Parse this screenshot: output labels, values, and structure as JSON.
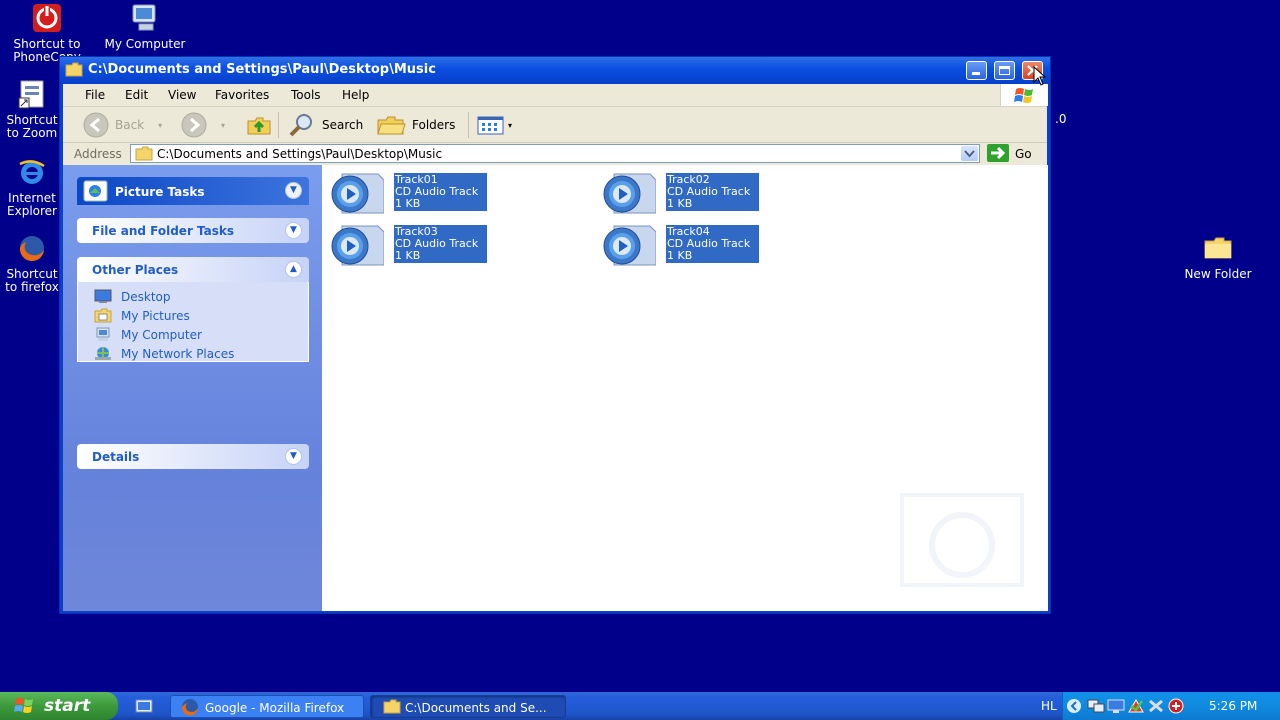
{
  "desktop": {
    "icons": [
      {
        "label": "Shortcut to PhoneCopy",
        "icon": "phonecopy-icon"
      },
      {
        "label": "My Computer",
        "icon": "my-computer-icon"
      },
      {
        "label": "Shortcut to Zoom",
        "icon": "zoom-shortcut-icon"
      },
      {
        "label": "Internet Explorer",
        "icon": "internet-explorer-icon"
      },
      {
        "label": "Shortcut to firefox",
        "icon": "firefox-icon"
      },
      {
        "label": "New Folder",
        "icon": "folder-icon"
      }
    ],
    "partial_text": ".0"
  },
  "window": {
    "title": "C:\\Documents and Settings\\Paul\\Desktop\\Music",
    "menu": [
      "File",
      "Edit",
      "View",
      "Favorites",
      "Tools",
      "Help"
    ],
    "toolbar": {
      "back_label": "Back",
      "search_label": "Search",
      "folders_label": "Folders"
    },
    "address": {
      "label": "Address",
      "value": "C:\\Documents and Settings\\Paul\\Desktop\\Music",
      "go_label": "Go"
    },
    "tasks": {
      "picture_tasks": "Picture Tasks",
      "file_folder_tasks": "File and Folder Tasks",
      "other_places": "Other Places",
      "places": [
        "Desktop",
        "My Pictures",
        "My Computer",
        "My Network Places"
      ],
      "details": "Details"
    },
    "files": [
      {
        "name": "Track01",
        "type": "CD Audio Track",
        "size": "1 KB"
      },
      {
        "name": "Track02",
        "type": "CD Audio Track",
        "size": "1 KB"
      },
      {
        "name": "Track03",
        "type": "CD Audio Track",
        "size": "1 KB"
      },
      {
        "name": "Track04",
        "type": "CD Audio Track",
        "size": "1 KB"
      }
    ]
  },
  "taskbar": {
    "start_label": "start",
    "buttons": [
      {
        "label": "Google - Mozilla Firefox",
        "active": false
      },
      {
        "label": "C:\\Documents and Se...",
        "active": true
      }
    ],
    "language": "HL",
    "clock": "5:26 PM"
  },
  "colors": {
    "desktop_bg": "#00008a",
    "selection": "#316ac5",
    "link": "#215dc6"
  }
}
